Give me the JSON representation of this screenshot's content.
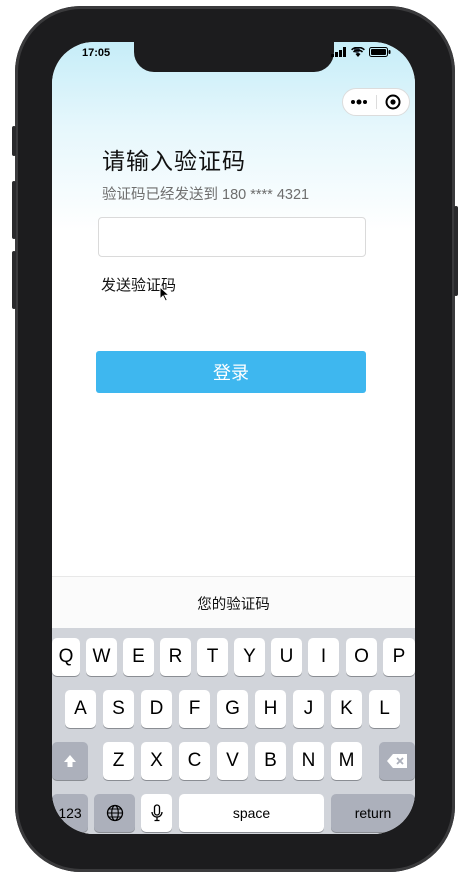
{
  "status_bar": {
    "time": "17:05"
  },
  "page": {
    "title": "请输入验证码",
    "subtitle": "验证码已经发送到 180 **** 4321",
    "code_input": {
      "value": "",
      "placeholder": ""
    },
    "send_code_link": "发送验证码",
    "login_button": "登录",
    "accent_color": "#3eb7ef"
  },
  "keyboard": {
    "toolbar_title": "您的验证码",
    "row1": [
      "Q",
      "W",
      "E",
      "R",
      "T",
      "Y",
      "U",
      "I",
      "O",
      "P"
    ],
    "row2": [
      "A",
      "S",
      "D",
      "F",
      "G",
      "H",
      "J",
      "K",
      "L"
    ],
    "row3": [
      "Z",
      "X",
      "C",
      "V",
      "B",
      "N",
      "M"
    ],
    "numbers_key": "123",
    "space_key": "space",
    "return_key": "return"
  }
}
